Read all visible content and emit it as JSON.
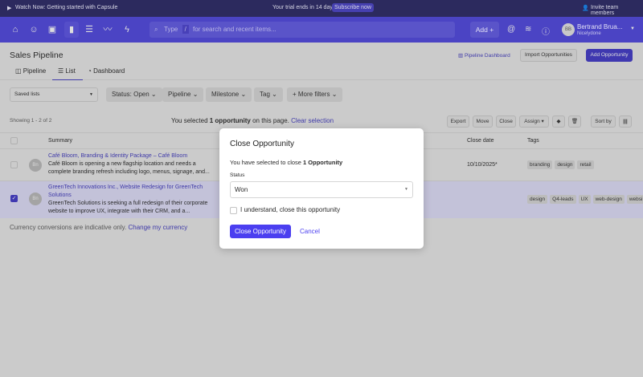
{
  "banner": {
    "watch": "Watch Now: Getting started with Capsule",
    "trial": "Your trial ends in 14 days",
    "subscribe": "Subscribe now",
    "invite": "Invite team members"
  },
  "nav": {
    "search_type": "Type",
    "search_slash": "/",
    "search_placeholder": "for search and recent items...",
    "add": "Add +",
    "user_name": "Bertrand Brua...",
    "user_org": "Nicelydone",
    "user_initials": "BB"
  },
  "header": {
    "title": "Sales Pipeline",
    "pipeline_dashboard": "Pipeline Dashboard",
    "import": "Import Opportunities",
    "add": "Add Opportunity"
  },
  "tabs": [
    {
      "label": "Pipeline"
    },
    {
      "label": "List"
    },
    {
      "label": "Dashboard"
    }
  ],
  "filters": {
    "saved_lists": "Saved lists",
    "status": "Status: Open",
    "pipeline": "Pipeline",
    "milestone": "Milestone",
    "tag": "Tag",
    "more": "+ More filters"
  },
  "toolbar": {
    "showing": "Showing 1 - 2 of 2",
    "sel_pre": "You selected ",
    "sel_bold": "1 opportunity",
    "sel_post": " on this page.",
    "clear": "Clear selection",
    "export": "Export",
    "move": "Move",
    "close": "Close",
    "assign": "Assign",
    "sort": "Sort by"
  },
  "table": {
    "headers": {
      "summary": "Summary",
      "close_date": "Close date",
      "tags": "Tags"
    },
    "rows": [
      {
        "initials": "Bn",
        "title": "Café Bloom, Branding & Identity Package – Café Bloom",
        "desc1": "Café Bloom is opening a new flagship location and needs a",
        "desc2": "complete branding refresh including logo, menus, signage, and...",
        "close_date": "10/10/2025*",
        "tags": [
          "branding",
          "design",
          "retail"
        ],
        "selected": false
      },
      {
        "initials": "Bn",
        "title": "GreenTech Innovations Inc., Website Redesign for GreenTech",
        "title2": "Solutions",
        "desc1": "GreenTech Solutions is seeking a full redesign of their corporate",
        "desc2": "website to improve UX, integrate with their CRM, and a...",
        "close_date": "",
        "tags": [
          "design",
          "Q4-leads",
          "UX",
          "web-design",
          "websi"
        ],
        "selected": true
      }
    ]
  },
  "footer": {
    "note": "Currency conversions are indicative only.",
    "link": "Change my currency"
  },
  "modal": {
    "title": "Close Opportunity",
    "msg_pre": "You have selected to close ",
    "msg_bold": "1 Opportunity",
    "status_label": "Status",
    "status_value": "Won",
    "confirm": "I understand, close this opportunity",
    "submit": "Close Opportunity",
    "cancel": "Cancel"
  },
  "colors": {
    "accent": "#4b3ff0",
    "nav": "#4b44c4"
  }
}
